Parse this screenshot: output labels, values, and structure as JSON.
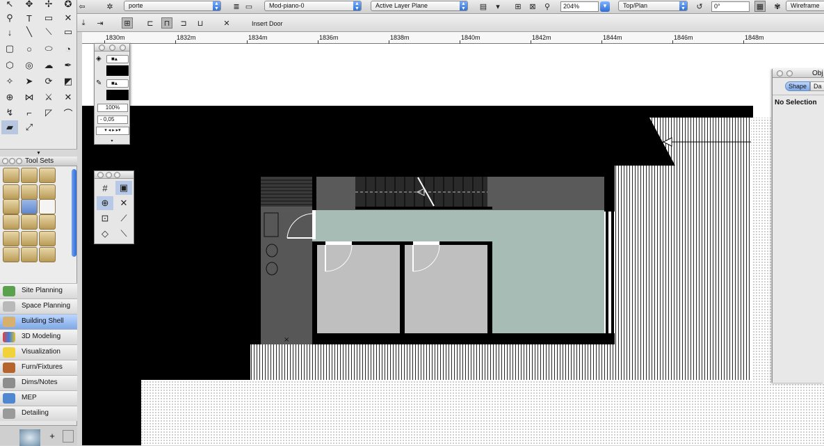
{
  "toolbar": {
    "class_popup": "porte",
    "layer_popup": "Mod-piano-0",
    "plane_popup": "Active Layer Plane",
    "zoom_value": "204%",
    "view_popup": "Top/Plan",
    "rotation_value": "0°",
    "render_popup": "Wireframe"
  },
  "mode_bar": {
    "tool_name": "Insert Door"
  },
  "ruler": {
    "labels": [
      "1830m",
      "1832m",
      "1834m",
      "1836m",
      "1838m",
      "1840m",
      "1842m",
      "1844m",
      "1846m",
      "1848m"
    ]
  },
  "attributes_palette": {
    "opacity": "100%",
    "line_weight": "- 0,05"
  },
  "tool_sets": {
    "title": "Tool Sets",
    "items": [
      {
        "label": "Site Planning"
      },
      {
        "label": "Space Planning"
      },
      {
        "label": "Building Shell"
      },
      {
        "label": "3D Modeling"
      },
      {
        "label": "Visualization"
      },
      {
        "label": "Furn/Fixtures"
      },
      {
        "label": "Dims/Notes"
      },
      {
        "label": "MEP"
      },
      {
        "label": "Detailing"
      }
    ],
    "selected": "Building Shell"
  },
  "obj_info": {
    "title": "Obj",
    "tab_shape": "Shape",
    "tab_data": "Da",
    "selection_text": "No Selection"
  },
  "bottom_bar": {
    "add_label": "+"
  },
  "colors": {
    "accent": "#3f7fe0",
    "corridor": "#a6bcb5",
    "room": "#bfbfbf",
    "wall": "#000000"
  }
}
